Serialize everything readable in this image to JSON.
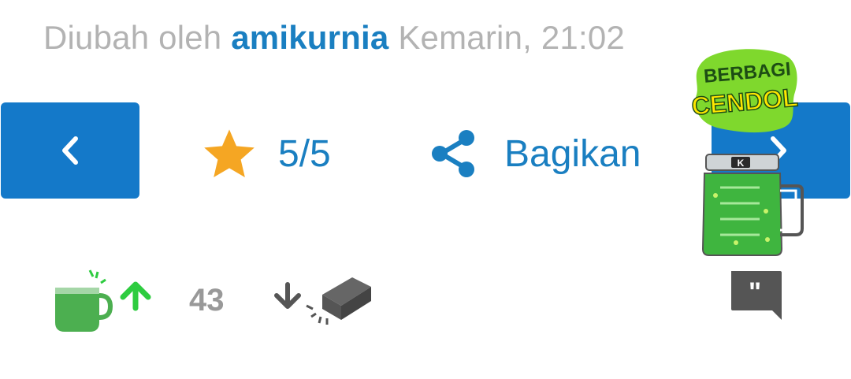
{
  "edit_info": {
    "prefix": "Diubah oleh",
    "user": "amikurnia",
    "time": "Kemarin, 21:02"
  },
  "nav": {
    "prev_icon": "chevron-left-icon",
    "next_icon": "chevron-right-icon"
  },
  "rating": {
    "icon": "star-icon",
    "value": "5/5"
  },
  "share": {
    "icon": "share-icon",
    "label": "Bagikan"
  },
  "promo": {
    "line1": "BERBAGI",
    "line2": "CENDOL",
    "icon": "cendol-jar-icon"
  },
  "votes": {
    "cendol_icon": "cendol-cup-icon",
    "count": "43",
    "bata_icon": "brick-icon"
  },
  "comment": {
    "icon": "quote-comment-icon"
  },
  "colors": {
    "accent_blue": "#1479c9",
    "link_blue": "#1a7fc1",
    "muted_gray": "#b3b3b3",
    "star_orange": "#f5a623",
    "cendol_green": "#4caf50",
    "upvote_green": "#2ecc40",
    "dark_gray": "#555555"
  }
}
